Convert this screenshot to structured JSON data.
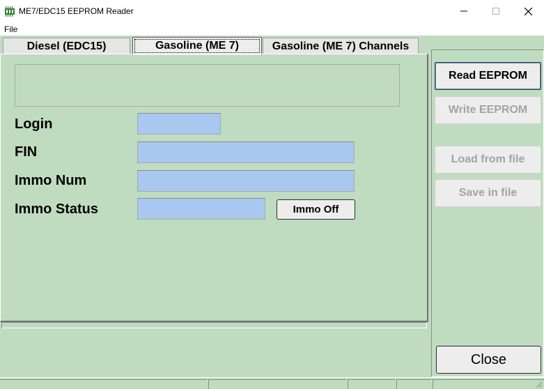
{
  "window": {
    "title": "ME7/EDC15 EEPROM Reader",
    "icon": "chip-icon"
  },
  "menu": {
    "file": "File"
  },
  "tabs": [
    {
      "label": "Diesel (EDC15)"
    },
    {
      "label": "Gasoline (ME 7)"
    },
    {
      "label": "Gasoline (ME 7) Channels"
    }
  ],
  "form": {
    "login_label": "Login",
    "login_value": "",
    "fin_label": "FIN",
    "fin_value": "",
    "immo_num_label": "Immo Num",
    "immo_num_value": "",
    "immo_status_label": "Immo Status",
    "immo_status_value": "",
    "immo_off_button": "Immo Off"
  },
  "actions": {
    "read_eeprom": "Read EEPROM",
    "write_eeprom": "Write EEPROM",
    "load_from_file": "Load from file",
    "save_in_file": "Save in file",
    "close": "Close"
  },
  "colors": {
    "background": "#c0dcc0",
    "input": "#a8c8f0",
    "disabled_text": "#a3a3a3"
  }
}
